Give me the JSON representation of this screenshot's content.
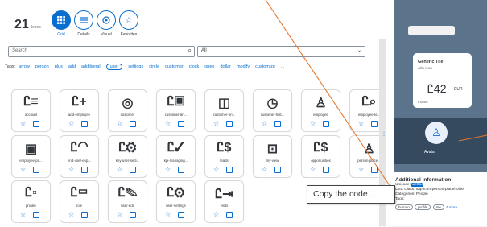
{
  "header": {
    "count": "21",
    "count_label": "Icons",
    "modes": [
      {
        "label": "Grid",
        "icon": "grid-icon",
        "active": true
      },
      {
        "label": "Details",
        "icon": "list-icon",
        "active": false
      },
      {
        "label": "Visual",
        "icon": "visual-icon",
        "active": false
      },
      {
        "label": "Favorites",
        "icon": "star-icon",
        "active": false
      }
    ]
  },
  "search": {
    "placeholder": "Search",
    "select_value": "All"
  },
  "tags": {
    "label": "Tags:",
    "items": [
      "arrow",
      "person",
      "plus",
      "add",
      "additional",
      "user",
      "settings",
      "circle",
      "customer",
      "clock",
      "open",
      "dollar",
      "modify",
      "customize",
      "..."
    ],
    "selected": "user"
  },
  "icons": [
    {
      "name": "account",
      "glyph": "Ꮭ≡"
    },
    {
      "name": "add-employee",
      "glyph": "Ꮭ+"
    },
    {
      "name": "customer",
      "glyph": "◎"
    },
    {
      "name": "customer-an...",
      "glyph": "Ꮭ▣"
    },
    {
      "name": "customer-bri...",
      "glyph": "◫"
    },
    {
      "name": "customer-hist...",
      "glyph": "◷"
    },
    {
      "name": "employee",
      "glyph": "♙"
    },
    {
      "name": "employee-lo...",
      "glyph": "Ꮭ⌕"
    },
    {
      "name": "employee-pa...",
      "glyph": "▣"
    },
    {
      "name": "end-user-exp...",
      "glyph": "Ꮭ◠"
    },
    {
      "name": "key-user-setti...",
      "glyph": "Ꮭ⚙"
    },
    {
      "name": "kpi-managing...",
      "glyph": "Ꮭ✓"
    },
    {
      "name": "leads",
      "glyph": "Ꮭ$"
    },
    {
      "name": "my-view",
      "glyph": "⊡"
    },
    {
      "name": "opportunities",
      "glyph": "Ꮭ$"
    },
    {
      "name": "person-place...",
      "glyph": "♙"
    },
    {
      "name": "private",
      "glyph": "Ꮭ▫"
    },
    {
      "name": "role",
      "glyph": "Ꮭ▭"
    },
    {
      "name": "user-edit",
      "glyph": "Ꮭ✎"
    },
    {
      "name": "user-settings",
      "glyph": "Ꮭ⚙"
    },
    {
      "name": "visits",
      "glyph": "Ꮭ⇥"
    }
  ],
  "preview": {
    "tile_title": "Generic Tile",
    "tile_subtitle": "with Icon",
    "kpi_value": "42",
    "kpi_unit": "EUR",
    "tile_footer": "Footer",
    "avatar_label": "Avatar"
  },
  "info": {
    "heading": "Additional Information",
    "unicode_prefix": "Unicode: ",
    "unicode_value": "\\ue0a4",
    "css_class": "CSS Class: sap-icon-person-placeholder",
    "categories": "Categories: People",
    "tags_label": "Tags:",
    "tag_pills": [
      "human",
      "profile",
      "me"
    ],
    "more": "4 more"
  },
  "callout": {
    "text": "Copy the code..."
  },
  "colors": {
    "accent": "#0a6ed1",
    "annotation_line": "#e8762c",
    "preview_bg": "#5b738b"
  }
}
